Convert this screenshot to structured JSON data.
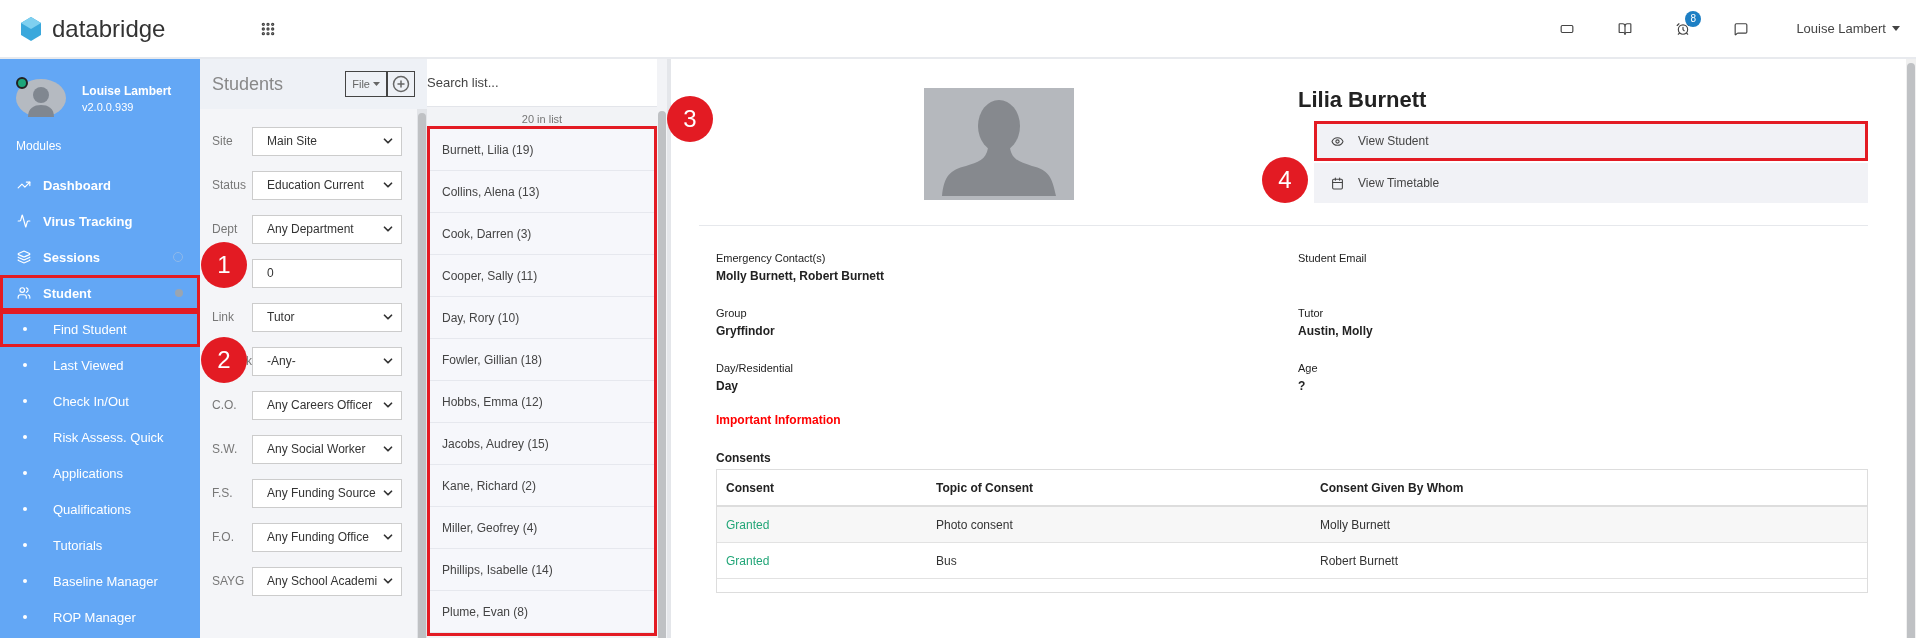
{
  "topbar": {
    "logo": "databridge",
    "notification_count": "8",
    "user": "Louise Lambert"
  },
  "sidebar": {
    "user": {
      "name": "Louise Lambert",
      "version": "v2.0.0.939",
      "online": true
    },
    "section": "Modules",
    "items": [
      {
        "label": "Dashboard",
        "kind": "module",
        "highlighted": false
      },
      {
        "label": "Virus Tracking",
        "kind": "module",
        "highlighted": false
      },
      {
        "label": "Sessions",
        "kind": "module",
        "highlighted": false,
        "dot": {
          "filled": false
        }
      },
      {
        "label": "Student",
        "kind": "module",
        "highlighted": true,
        "dot": {
          "filled": true
        },
        "callout": "1"
      },
      {
        "label": "Find Student",
        "kind": "link",
        "highlighted": true,
        "callout": "2"
      },
      {
        "label": "Last Viewed",
        "kind": "link",
        "highlighted": false
      },
      {
        "label": "Check In/Out",
        "kind": "link",
        "highlighted": false
      },
      {
        "label": "Risk Assess. Quick",
        "kind": "link",
        "highlighted": false
      },
      {
        "label": "Applications",
        "kind": "link",
        "highlighted": false
      },
      {
        "label": "Qualifications",
        "kind": "link",
        "highlighted": false
      },
      {
        "label": "Tutorials",
        "kind": "link",
        "highlighted": false
      },
      {
        "label": "Baseline Manager",
        "kind": "link",
        "highlighted": false
      },
      {
        "label": "ROP Manager",
        "kind": "link",
        "highlighted": false
      }
    ]
  },
  "filters": {
    "title": "Students",
    "file_button": "File",
    "fields": [
      {
        "label": "Site",
        "kind": "select",
        "value": "Main Site"
      },
      {
        "label": "Status",
        "kind": "select",
        "value": "Education Current"
      },
      {
        "label": "Dept",
        "kind": "select",
        "value": "Any Department"
      },
      {
        "kind": "input",
        "value": "0"
      },
      {
        "label": "Link",
        "kind": "select",
        "value": "Tutor"
      },
      {
        "label": "k",
        "kind": "select",
        "value": "-Any-",
        "partly_covered": true
      },
      {
        "label": "C.O.",
        "kind": "select",
        "value": "Any Careers Officer"
      },
      {
        "label": "S.W.",
        "kind": "select",
        "value": "Any Social Worker"
      },
      {
        "label": "F.S.",
        "kind": "select",
        "value": "Any Funding Source"
      },
      {
        "label": "F.O.",
        "kind": "select",
        "value": "Any Funding Office"
      },
      {
        "label": "SAYG",
        "kind": "select",
        "value": "Any School Academi"
      }
    ]
  },
  "list": {
    "placeholder": "Search list...",
    "count": "20 in list",
    "highlighted": true,
    "callout": "3",
    "items": [
      "Burnett, Lilia (19)",
      "Collins, Alena (13)",
      "Cook, Darren (3)",
      "Cooper, Sally (11)",
      "Day, Rory (10)",
      "Fowler, Gillian (18)",
      "Hobbs, Emma (12)",
      "Jacobs, Audrey (15)",
      "Kane, Richard (2)",
      "Miller, Geofrey (4)",
      "Phillips, Isabelle (14)",
      "Plume, Evan (8)"
    ]
  },
  "student": {
    "name": "Lilia Burnett",
    "actions": [
      {
        "label": "View Student",
        "kind": "view",
        "highlighted": true,
        "callout": "4"
      },
      {
        "label": "View Timetable",
        "kind": "timetable",
        "highlighted": false
      }
    ],
    "fields": [
      {
        "label": "Emergency Contact(s)",
        "value": "Molly Burnett, Robert Burnett"
      },
      {
        "label": "Student Email"
      },
      {
        "label": "Group",
        "value": "Gryffindor"
      },
      {
        "label": "Tutor",
        "value": "Austin, Molly"
      },
      {
        "label": "Day/Residential",
        "value": "Day"
      },
      {
        "label": "Age",
        "value": "?"
      }
    ],
    "important": "Important Information",
    "consents": {
      "title": "Consents",
      "columns": [
        "Consent",
        "Topic of Consent",
        "Consent Given By Whom"
      ],
      "rows": [
        {
          "consent": "Granted",
          "topic": "Photo consent",
          "by": "Molly Burnett"
        },
        {
          "consent": "Granted",
          "topic": "Bus",
          "by": "Robert Burnett"
        }
      ]
    }
  }
}
